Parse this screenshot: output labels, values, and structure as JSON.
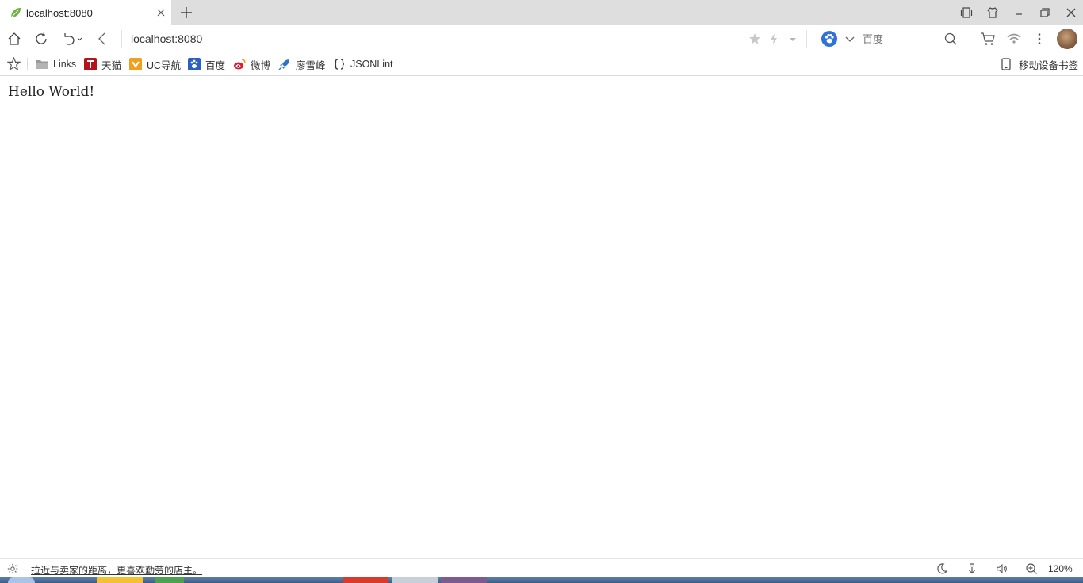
{
  "tab": {
    "title": "localhost:8080"
  },
  "address_bar": {
    "url": "localhost:8080"
  },
  "search": {
    "engine": "百度",
    "placeholder": "百度"
  },
  "bookmarks": [
    {
      "label": "Links",
      "icon": "folder-icon"
    },
    {
      "label": "天猫",
      "icon": "tmall-icon"
    },
    {
      "label": "UC导航",
      "icon": "uc-nav-icon"
    },
    {
      "label": "百度",
      "icon": "baidu-icon"
    },
    {
      "label": "微博",
      "icon": "weibo-icon"
    },
    {
      "label": "廖雪峰",
      "icon": "rocket-icon"
    },
    {
      "label": "JSONLint",
      "icon": "braces-icon"
    }
  ],
  "mobile_bookmarks": {
    "label": "移动设备书签"
  },
  "page": {
    "content": "Hello World!"
  },
  "status": {
    "message": "拉近与卖家的距离，更喜欢勤劳的店主。",
    "zoom": "120%"
  },
  "colors": {
    "accent": "#1a6fd6",
    "tab_strip": "#dedede",
    "taskbar": "#3e5f86"
  }
}
